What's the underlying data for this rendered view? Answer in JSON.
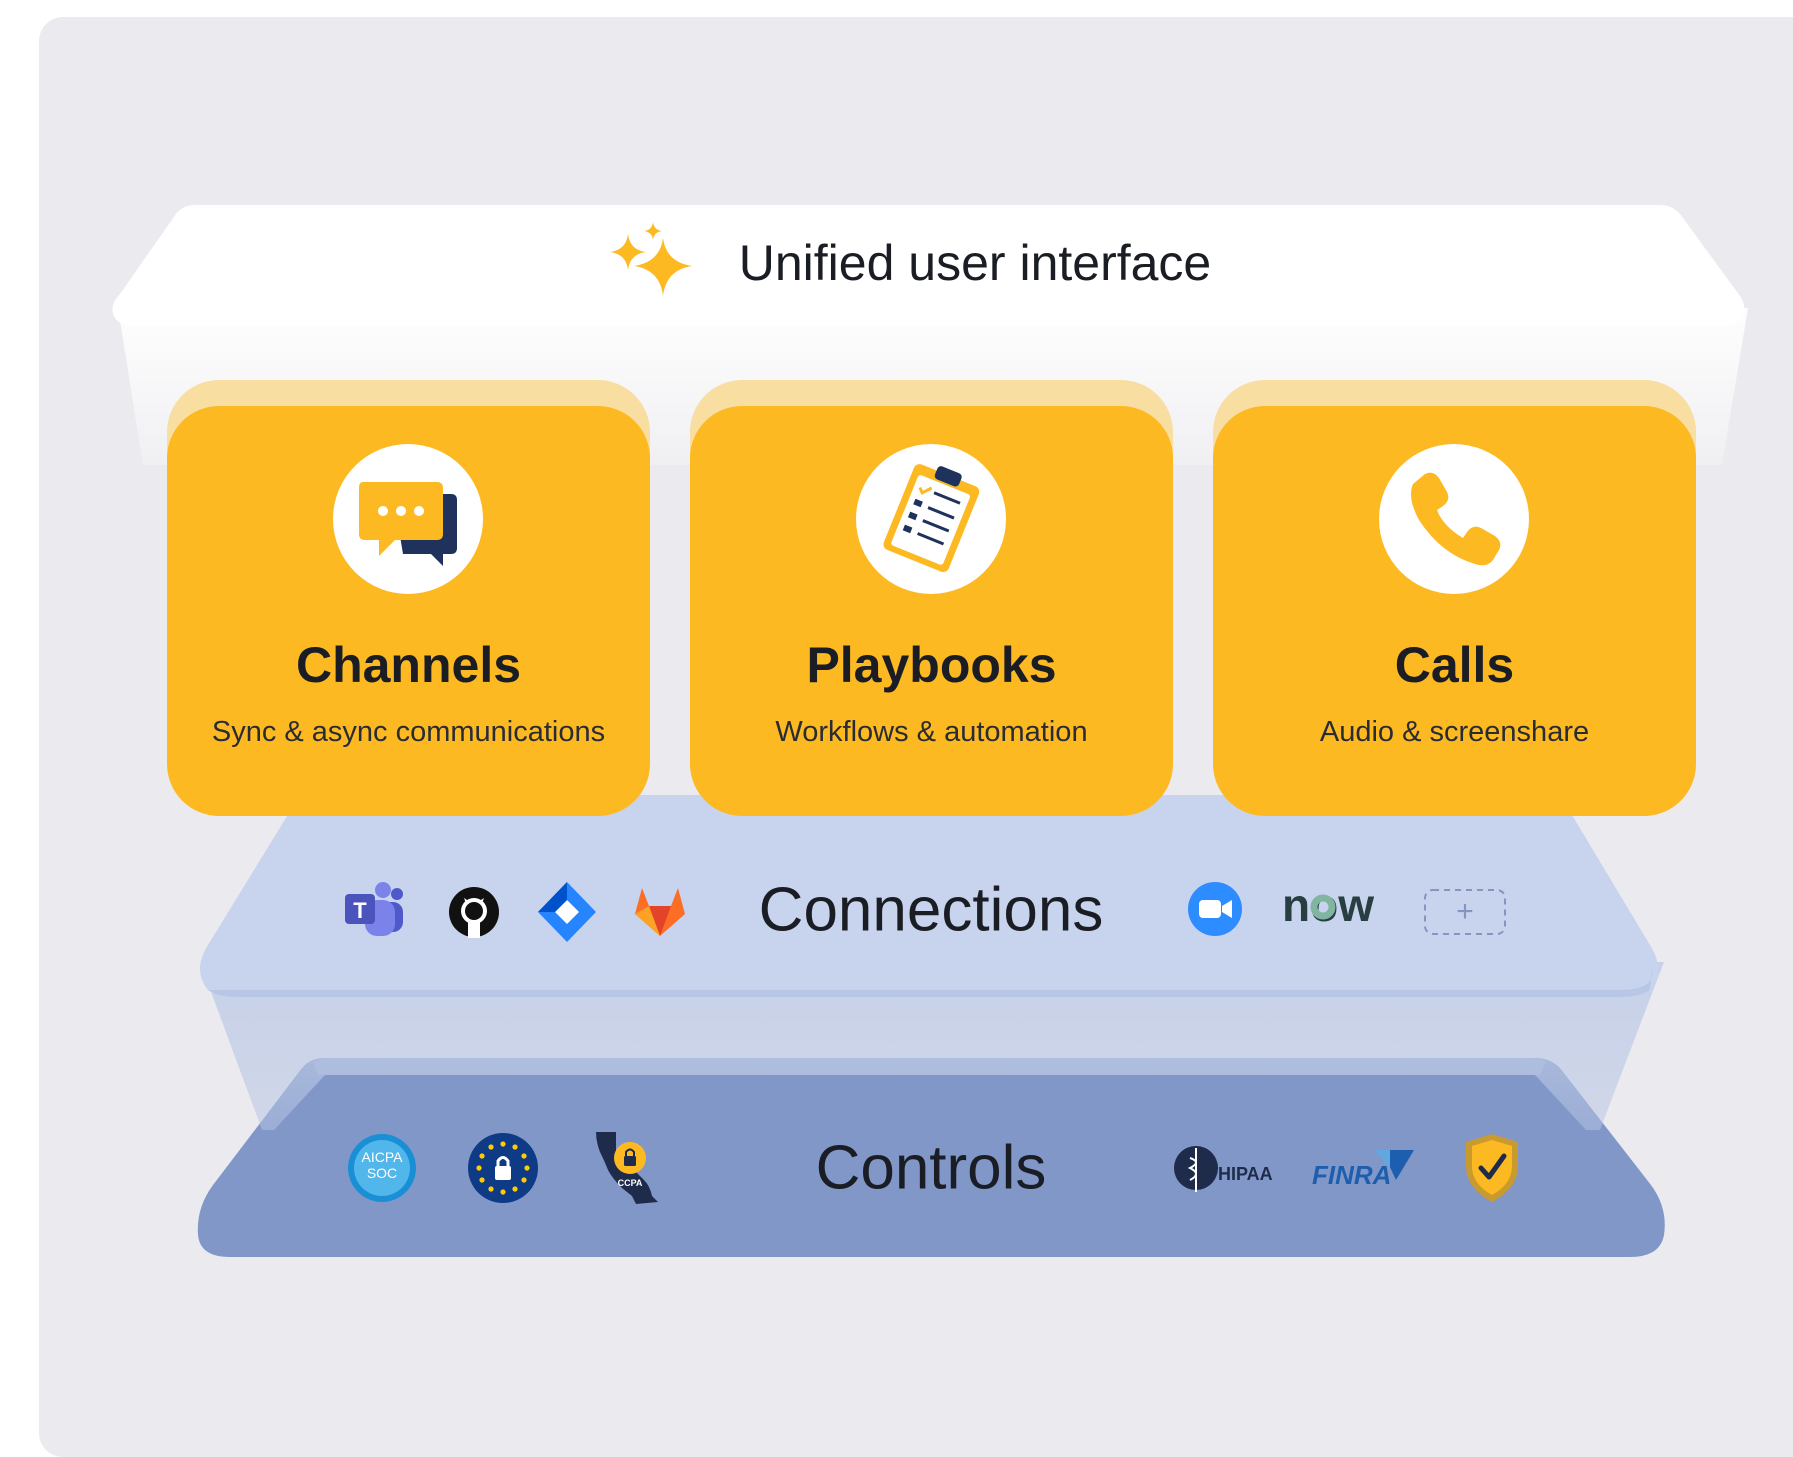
{
  "layers": {
    "ui": {
      "title": "Unified user interface"
    },
    "connections": {
      "title": "Connections"
    },
    "controls": {
      "title": "Controls"
    }
  },
  "cards": [
    {
      "title": "Channels",
      "subtitle": "Sync & async communications",
      "icon": "chat-bubbles-icon"
    },
    {
      "title": "Playbooks",
      "subtitle": "Workflows & automation",
      "icon": "clipboard-checklist-icon"
    },
    {
      "title": "Calls",
      "subtitle": "Audio & screenshare",
      "icon": "phone-icon"
    }
  ],
  "connection_icons": {
    "teams": {
      "name": "microsoft-teams-icon",
      "letter": "T"
    },
    "github": {
      "name": "github-icon"
    },
    "jira": {
      "name": "jira-icon"
    },
    "gitlab": {
      "name": "gitlab-icon"
    },
    "zoom": {
      "name": "zoom-icon"
    },
    "servicenow": {
      "name": "servicenow-icon",
      "text": "now"
    },
    "add": {
      "name": "add-connection-icon",
      "text": "+"
    }
  },
  "control_badges": {
    "soc": {
      "name": "aicpa-soc-badge-icon",
      "line1": "AICPA",
      "line2": "SOC"
    },
    "gdpr": {
      "name": "gdpr-eu-badge-icon"
    },
    "ccpa": {
      "name": "ccpa-badge-icon",
      "text": "CCPA"
    },
    "hipaa": {
      "name": "hipaa-badge-icon",
      "text": "HIPAA"
    },
    "finra": {
      "name": "finra-badge-icon",
      "text": "FINRA"
    },
    "shield": {
      "name": "security-shield-icon"
    }
  },
  "colors": {
    "card": "#fdb922",
    "card_back": "#f9dea1",
    "connections_layer": "#c8d4ed",
    "controls_layer": "#8097c8",
    "panel": "#ebebef"
  }
}
